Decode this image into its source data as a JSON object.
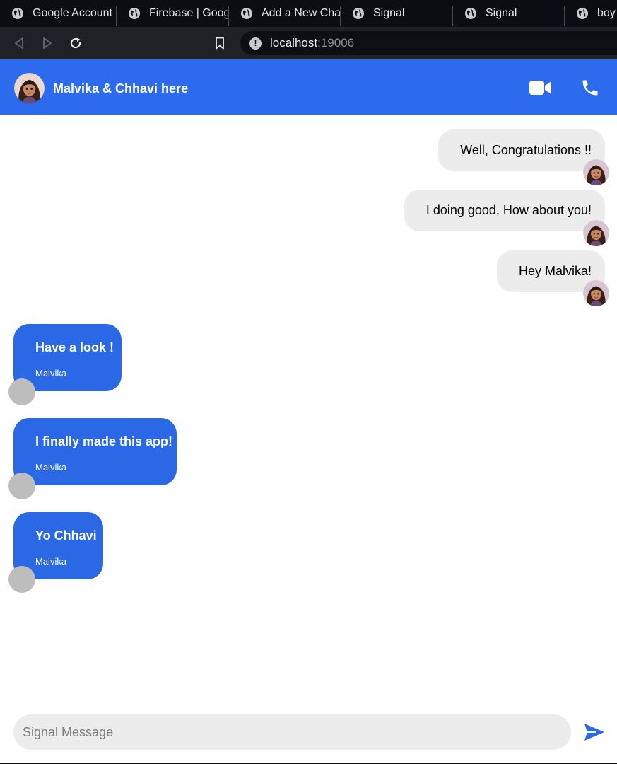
{
  "browser": {
    "tabs": [
      {
        "title": "Google Account"
      },
      {
        "title": "Firebase | Google"
      },
      {
        "title": "Add a New Chat"
      },
      {
        "title": "Signal"
      },
      {
        "title": "Signal"
      },
      {
        "title": "boy n"
      }
    ],
    "url_host": "localhost",
    "url_port": ":19006"
  },
  "chat": {
    "title": "Malvika & Chhavi here",
    "outgoing": [
      {
        "text": "Well, Congratulations !!"
      },
      {
        "text": "I doing good, How about you!"
      },
      {
        "text": "Hey Malvika!"
      }
    ],
    "incoming": [
      {
        "text": "Have a look !",
        "sender": "Malvika"
      },
      {
        "text": "I finally made this app!",
        "sender": "Malvika"
      },
      {
        "text": "Yo Chhavi",
        "sender": "Malvika"
      }
    ],
    "input_placeholder": "Signal Message"
  },
  "colors": {
    "brand": "#2c6bed",
    "incoming_bubble": "#2b68e6",
    "outgoing_bubble": "#ececec"
  }
}
